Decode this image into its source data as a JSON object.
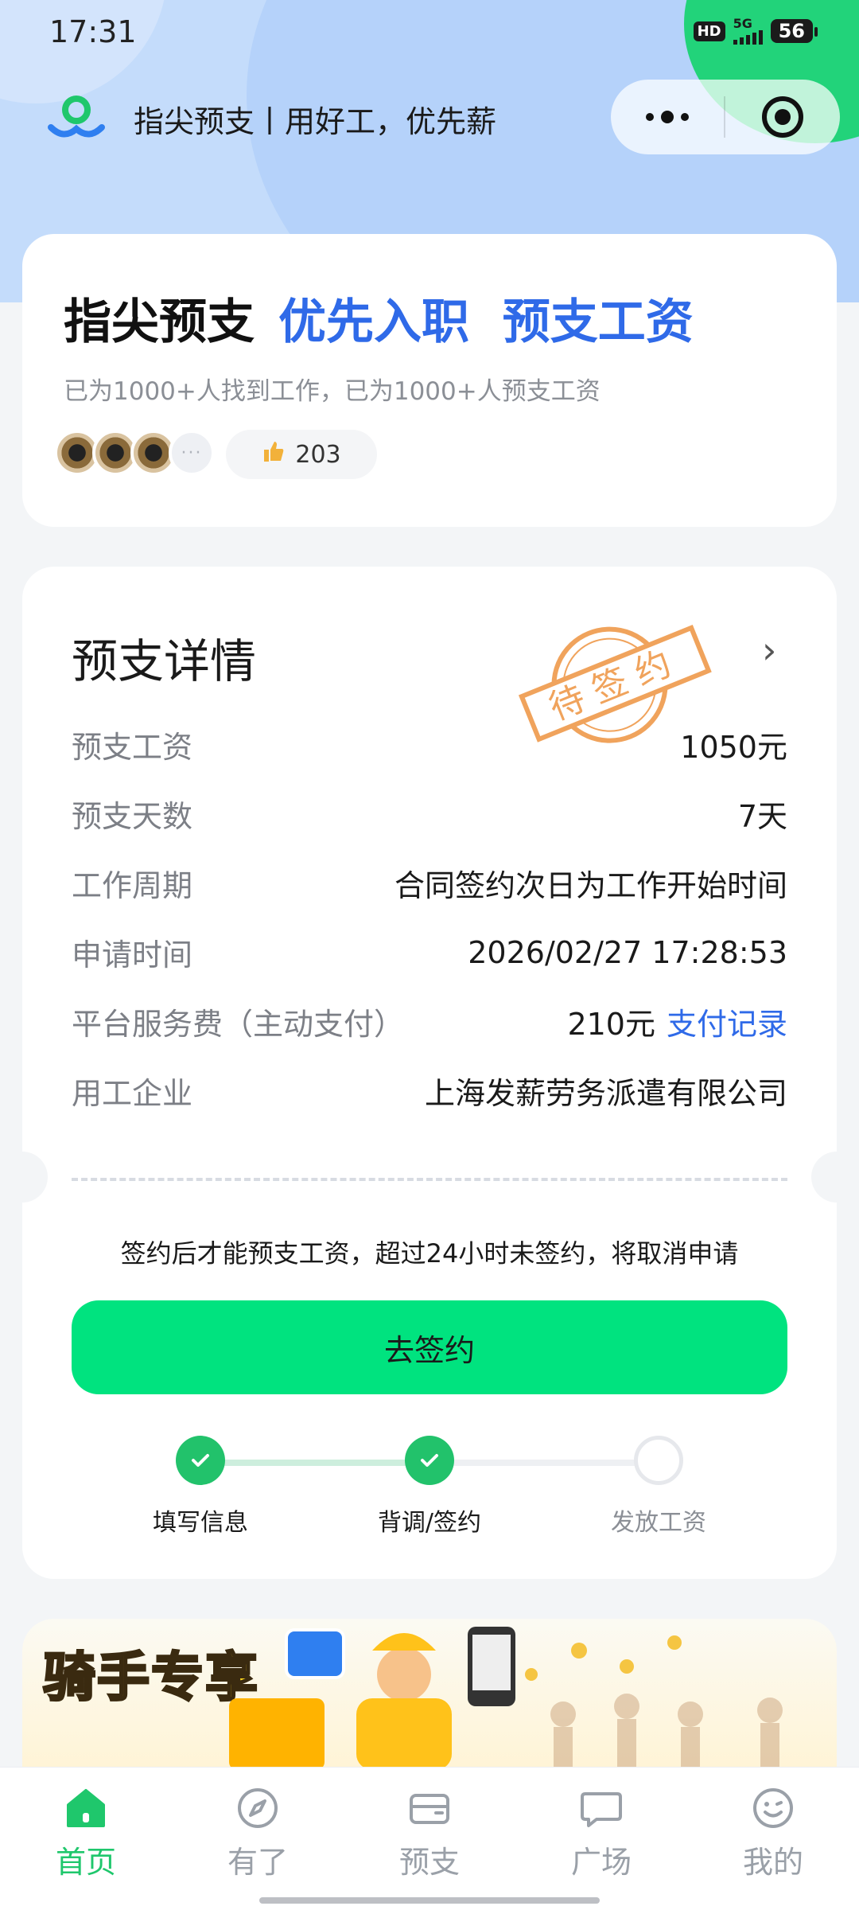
{
  "status_bar": {
    "time": "17:31",
    "hd": "HD",
    "network": "5G",
    "battery": "56"
  },
  "app_header": {
    "title": "指尖预支丨用好工，优先薪",
    "icons": [
      "app-logo-icon",
      "more-icon",
      "target-icon"
    ]
  },
  "intro": {
    "headline_dark": "指尖预支",
    "headline_blue": "优先入职  预支工资",
    "subtitle": "已为1000+人找到工作，已为1000+人预支工资",
    "more_avatars": "···",
    "like_count": "203"
  },
  "detail": {
    "title": "预支详情",
    "stamp_text": "待签约",
    "rows": [
      {
        "label": "预支工资",
        "value": "1050元"
      },
      {
        "label": "预支天数",
        "value": "7天"
      },
      {
        "label": "工作周期",
        "value": "合同签约次日为工作开始时间"
      },
      {
        "label": "申请时间",
        "value": "2026/02/27 17:28:53"
      },
      {
        "label": "平台服务费（主动支付）",
        "value": "210元",
        "link": "支付记录"
      },
      {
        "label": "用工企业",
        "value": "上海发薪劳务派遣有限公司"
      }
    ],
    "notice": "签约后才能预支工资，超过24小时未签约，将取消申请",
    "sign_button": "去签约",
    "steps": [
      {
        "label": "填写信息",
        "state": "done"
      },
      {
        "label": "背调/签约",
        "state": "done"
      },
      {
        "label": "发放工资",
        "state": "pending"
      }
    ]
  },
  "banner": {
    "title": "骑手专享"
  },
  "tabbar": {
    "items": [
      {
        "label": "首页",
        "icon": "home-icon",
        "active": true
      },
      {
        "label": "有了",
        "icon": "compass-icon",
        "active": false
      },
      {
        "label": "预支",
        "icon": "wallet-icon",
        "active": false
      },
      {
        "label": "广场",
        "icon": "chat-icon",
        "active": false
      },
      {
        "label": "我的",
        "icon": "smile-icon",
        "active": false
      }
    ]
  },
  "colors": {
    "accent_green": "#00e37f",
    "active_tab_green": "#1fc76c",
    "link_blue": "#2f6ae8",
    "stamp_orange": "#f0a35c"
  }
}
